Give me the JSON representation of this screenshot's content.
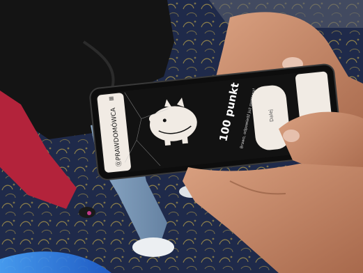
{
  "photo": {
    "subject": "hand-holding-smartphone",
    "carpet_color": "#1f2a4a",
    "carpet_pattern_color": "#b9a24a",
    "skin_color": "#c98e6f",
    "jeans_color": "#7c99b8",
    "jacket_color": "#141414",
    "red_garment_color": "#b3233b"
  },
  "phone_screen": {
    "brand": "⓪PRAWDOMÓWCA",
    "points_text": "100 punkt",
    "subtitle_text": "Brawo, odpowiedź już zapisana!",
    "button_label": "Dalej",
    "mascot_icon": "piggy-mascot-icon",
    "screen_bg": "#121212",
    "card_color": "#f1ebe4"
  }
}
